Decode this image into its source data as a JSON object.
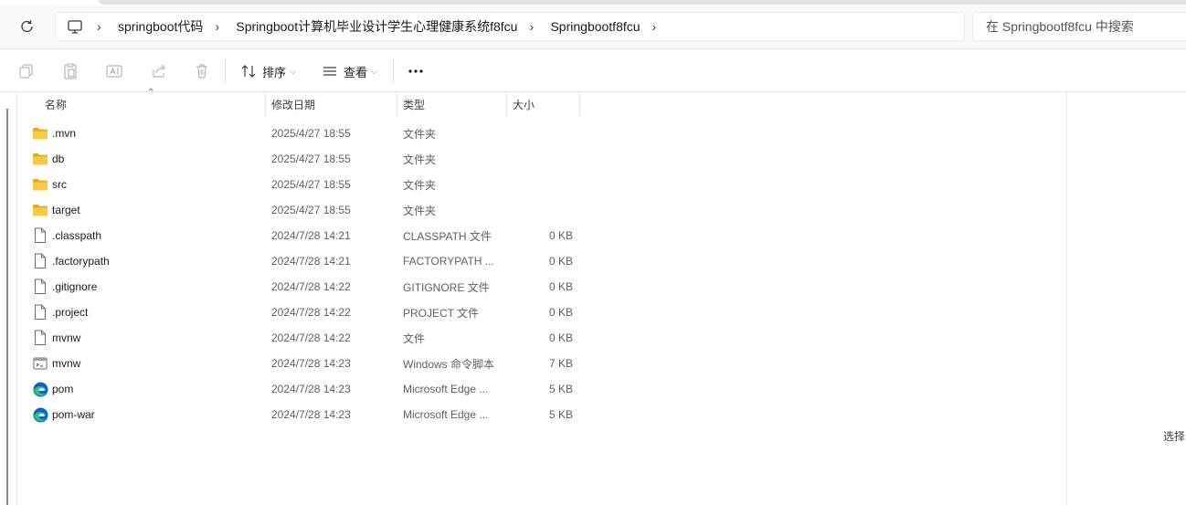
{
  "window": {
    "breadcrumb": [
      "springboot代码",
      "Springboot计算机毕业设计学生心理健康系统f8fcu",
      "Springbootf8fcu"
    ],
    "search_placeholder": "在 Springbootf8fcu 中搜索"
  },
  "toolbar": {
    "sort_label": "排序",
    "view_label": "查看",
    "more_label": "..."
  },
  "columns": {
    "name": "名称",
    "date": "修改日期",
    "type": "类型",
    "size": "大小"
  },
  "files": [
    {
      "name": ".mvn",
      "date": "2025/4/27 18:55",
      "type": "文件夹",
      "size": "",
      "icon": "folder-icon"
    },
    {
      "name": "db",
      "date": "2025/4/27 18:55",
      "type": "文件夹",
      "size": "",
      "icon": "folder-icon"
    },
    {
      "name": "src",
      "date": "2025/4/27 18:55",
      "type": "文件夹",
      "size": "",
      "icon": "folder-icon"
    },
    {
      "name": "target",
      "date": "2025/4/27 18:55",
      "type": "文件夹",
      "size": "",
      "icon": "folder-icon"
    },
    {
      "name": ".classpath",
      "date": "2024/7/28 14:21",
      "type": "CLASSPATH 文件",
      "size": "0 KB",
      "icon": "file-icon"
    },
    {
      "name": ".factorypath",
      "date": "2024/7/28 14:21",
      "type": "FACTORYPATH ...",
      "size": "0 KB",
      "icon": "file-icon"
    },
    {
      "name": ".gitignore",
      "date": "2024/7/28 14:22",
      "type": "GITIGNORE 文件",
      "size": "0 KB",
      "icon": "file-icon"
    },
    {
      "name": ".project",
      "date": "2024/7/28 14:22",
      "type": "PROJECT 文件",
      "size": "0 KB",
      "icon": "file-icon"
    },
    {
      "name": "mvnw",
      "date": "2024/7/28 14:22",
      "type": "文件",
      "size": "0 KB",
      "icon": "file-icon"
    },
    {
      "name": "mvnw",
      "date": "2024/7/28 14:23",
      "type": "Windows 命令脚本",
      "size": "7 KB",
      "icon": "script-icon"
    },
    {
      "name": "pom",
      "date": "2024/7/28 14:23",
      "type": "Microsoft Edge ...",
      "size": "5 KB",
      "icon": "edge-icon"
    },
    {
      "name": "pom-war",
      "date": "2024/7/28 14:23",
      "type": "Microsoft Edge ...",
      "size": "5 KB",
      "icon": "edge-icon"
    }
  ],
  "preview_pane": {
    "text": "选择"
  },
  "colors": {
    "folder": "#f7c948",
    "folder_dark": "#e6a817",
    "edge_blue": "#0c63c9",
    "edge_green": "#35c26f"
  }
}
